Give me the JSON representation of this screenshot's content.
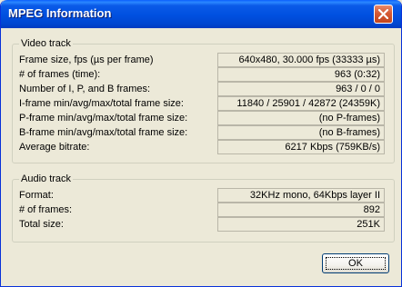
{
  "window": {
    "title": "MPEG Information"
  },
  "video": {
    "title": "Video track",
    "rows": [
      {
        "label": "Frame size, fps (µs per frame)",
        "value": "640x480, 30.000 fps (33333 µs)"
      },
      {
        "label": "# of frames (time):",
        "value": "963 (0:32)"
      },
      {
        "label": "Number of I, P, and B frames:",
        "value": "963 / 0 / 0"
      },
      {
        "label": "I-frame min/avg/max/total frame size:",
        "value": "11840 / 25901 / 42872 (24359K)"
      },
      {
        "label": "P-frame min/avg/max/total frame size:",
        "value": "(no P-frames)"
      },
      {
        "label": "B-frame min/avg/max/total frame size:",
        "value": "(no B-frames)"
      },
      {
        "label": "Average bitrate:",
        "value": "6217 Kbps (759KB/s)"
      }
    ]
  },
  "audio": {
    "title": "Audio track",
    "rows": [
      {
        "label": "Format:",
        "value": "32KHz mono, 64Kbps layer II"
      },
      {
        "label": "# of frames:",
        "value": "892"
      },
      {
        "label": "Total size:",
        "value": "251K"
      }
    ]
  },
  "buttons": {
    "ok": "OK"
  }
}
